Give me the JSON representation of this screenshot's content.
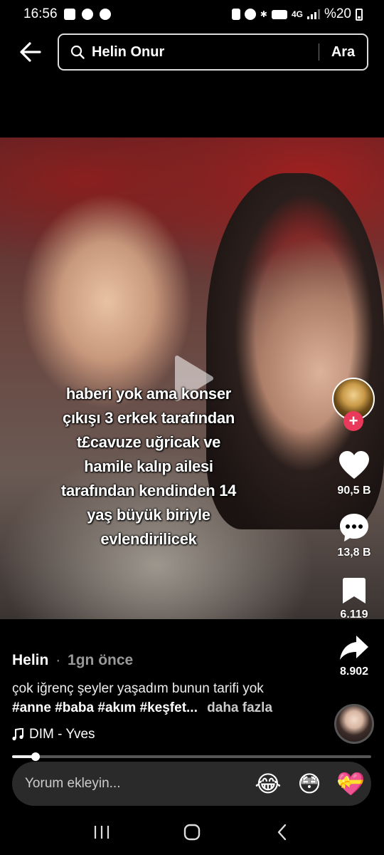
{
  "status_bar": {
    "time": "16:56",
    "network": "4G",
    "battery": "%20",
    "left_icons": [
      "gallery-icon",
      "notification-icon",
      "pinterest-icon"
    ],
    "right_icons": [
      "vibrate-icon",
      "alarm-icon",
      "bluetooth-icon",
      "hd-icon",
      "signal-icon",
      "battery-icon"
    ]
  },
  "search": {
    "query": "Helin Onur",
    "button": "Ara"
  },
  "video": {
    "overlay_text": [
      "haberi yok ama konser",
      "çıkışı 3 erkek tarafından",
      "t£cavuze uğricak ve",
      "hamile kalıp ailesi",
      "tarafından kendinden 14",
      "yaş büyük biriyle",
      "evlendirilicek"
    ]
  },
  "actions": {
    "likes": "90,5 B",
    "comments": "13,8 B",
    "saves": "6.119",
    "shares": "8.902",
    "follow_symbol": "+"
  },
  "post": {
    "author": "Helin",
    "separator": "·",
    "time": "1gn önce",
    "caption": "çok iğrenç şeyler yaşadım bunun tarifi yok",
    "hashtags": "#anne #baba #akım #keşfet...",
    "more": "daha fazla",
    "music": "DIM - Yves"
  },
  "progress": {
    "fraction": 0.066
  },
  "comment_bar": {
    "placeholder": "Yorum ekleyin...",
    "emojis": [
      "😂",
      "😳",
      "💝"
    ]
  },
  "colors": {
    "background": "#000000",
    "follow": "#ea3a5c",
    "comment_bar": "#2a2a2a"
  }
}
